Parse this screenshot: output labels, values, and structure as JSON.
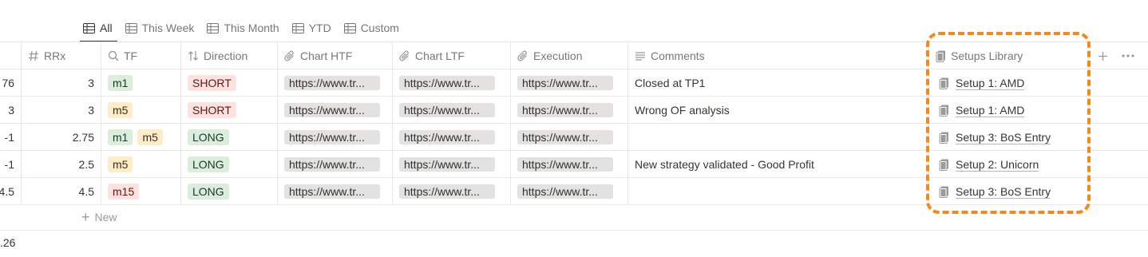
{
  "tabs": [
    {
      "label": "All",
      "active": true
    },
    {
      "label": "This Week",
      "active": false
    },
    {
      "label": "This Month",
      "active": false
    },
    {
      "label": "YTD",
      "active": false
    },
    {
      "label": "Custom",
      "active": false
    }
  ],
  "columns": {
    "rrx": "RRx",
    "tf": "TF",
    "direction": "Direction",
    "chart_htf": "Chart HTF",
    "chart_ltf": "Chart LTF",
    "execution": "Execution",
    "comments": "Comments",
    "setups": "Setups Library"
  },
  "rows": [
    {
      "prev": "76",
      "rrx": "3",
      "tf": [
        "m1"
      ],
      "direction": "SHORT",
      "chart_htf": "https://www.tr...",
      "chart_ltf": "https://www.tr...",
      "execution": "https://www.tr...",
      "comments": "Closed at TP1",
      "setup": "Setup 1: AMD"
    },
    {
      "prev": "3",
      "rrx": "3",
      "tf": [
        "m5"
      ],
      "direction": "SHORT",
      "chart_htf": "https://www.tr...",
      "chart_ltf": "https://www.tr...",
      "execution": "https://www.tr...",
      "comments": "Wrong OF analysis",
      "setup": "Setup 1: AMD"
    },
    {
      "prev": "-1",
      "rrx": "2.75",
      "tf": [
        "m1",
        "m5"
      ],
      "direction": "LONG",
      "chart_htf": "https://www.tr...",
      "chart_ltf": "https://www.tr...",
      "execution": "https://www.tr...",
      "comments": "",
      "setup": "Setup 3: BoS Entry"
    },
    {
      "prev": "-1",
      "rrx": "2.5",
      "tf": [
        "m5"
      ],
      "direction": "LONG",
      "chart_htf": "https://www.tr...",
      "chart_ltf": "https://www.tr...",
      "execution": "https://www.tr...",
      "comments": "New strategy validated - Good Profit",
      "setup": "Setup 2: Unicorn"
    },
    {
      "prev": "4.5",
      "rrx": "4.5",
      "tf": [
        "m15"
      ],
      "direction": "LONG",
      "chart_htf": "https://www.tr...",
      "chart_ltf": "https://www.tr...",
      "execution": "https://www.tr...",
      "comments": "",
      "setup": "Setup 3: BoS Entry"
    }
  ],
  "new_row_label": "New",
  "footer_value": ".26",
  "colors": {
    "highlight": "#f08a1c",
    "tag_green": "#dbeddb",
    "tag_yellow": "#fdecc8",
    "tag_red": "#ffe2dd",
    "url_bg": "#e3e2e0"
  },
  "tag_colors": {
    "m1": "green",
    "m5": "yellow",
    "m15": "red",
    "SHORT": "red",
    "LONG": "green"
  },
  "icons": {
    "tab": "table-icon",
    "rrx": "hash-icon",
    "tf": "search-icon",
    "direction": "sort-arrows-icon",
    "attachment": "paperclip-icon",
    "comments": "text-lines-icon",
    "setups": "page-icon",
    "add": "plus-icon",
    "more": "ellipsis-icon"
  }
}
